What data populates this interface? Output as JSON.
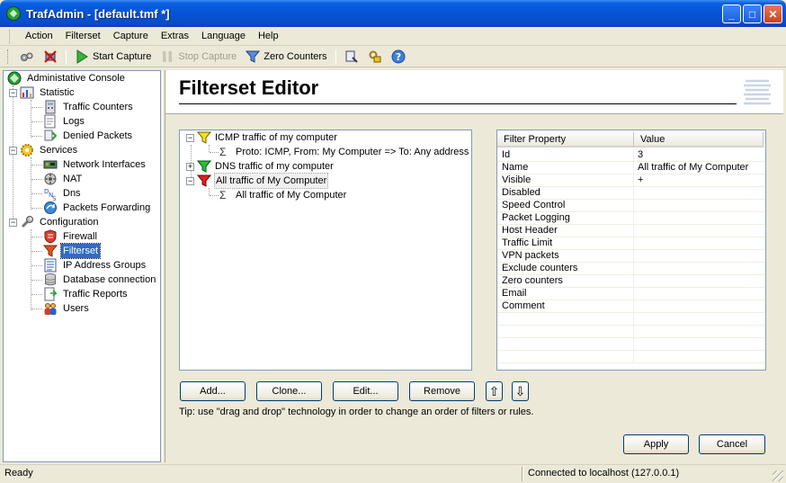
{
  "window": {
    "title": "TrafAdmin - [default.tmf *]",
    "minimize": "_",
    "maximize": "□",
    "close": "✕"
  },
  "menu": [
    "Action",
    "Filterset",
    "Capture",
    "Extras",
    "Language",
    "Help"
  ],
  "toolbar": {
    "start_capture": "Start Capture",
    "stop_capture": "Stop Capture",
    "zero_counters": "Zero Counters"
  },
  "nav_tree": {
    "root": "Administative Console",
    "statistic": "Statistic",
    "traffic_counters": "Traffic Counters",
    "logs": "Logs",
    "denied_packets": "Denied Packets",
    "services": "Services",
    "network_interfaces": "Network Interfaces",
    "nat": "NAT",
    "dns": "Dns",
    "packets_forwarding": "Packets Forwarding",
    "configuration": "Configuration",
    "firewall": "Firewall",
    "filterset": "Filterset",
    "ip_address_groups": "IP Address Groups",
    "database_connection": "Database connection",
    "traffic_reports": "Traffic Reports",
    "users": "Users"
  },
  "editor": {
    "title": "Filterset Editor",
    "filters": {
      "icmp": "ICMP traffic of my computer",
      "icmp_rule": "Proto: ICMP, From: My Computer  => To: Any address",
      "dns": "DNS traffic of my computer",
      "all": "All traffic of My Computer",
      "all_rule": "All traffic of My Computer"
    },
    "props_header": {
      "property": "Filter Property",
      "value": "Value"
    },
    "props": [
      {
        "name": "Id",
        "value": "3"
      },
      {
        "name": "Name",
        "value": "All traffic of My Computer"
      },
      {
        "name": "Visible",
        "value": "+"
      },
      {
        "name": "Disabled",
        "value": ""
      },
      {
        "name": "Speed Control",
        "value": ""
      },
      {
        "name": "Packet Logging",
        "value": ""
      },
      {
        "name": "Host Header",
        "value": ""
      },
      {
        "name": "Traffic Limit",
        "value": ""
      },
      {
        "name": "VPN packets",
        "value": ""
      },
      {
        "name": "Exclude counters",
        "value": ""
      },
      {
        "name": "Zero counters",
        "value": ""
      },
      {
        "name": "Email",
        "value": ""
      },
      {
        "name": "Comment",
        "value": ""
      }
    ],
    "buttons": {
      "add": "Add...",
      "clone": "Clone...",
      "edit": "Edit...",
      "remove": "Remove",
      "up": "⇧",
      "down": "⇩"
    },
    "tip": "Tip: use \"drag and drop\" technology in order to change an order of filters or rules.",
    "apply": "Apply",
    "cancel": "Cancel"
  },
  "status": {
    "left": "Ready",
    "right": "Connected to localhost (127.0.0.1)"
  }
}
